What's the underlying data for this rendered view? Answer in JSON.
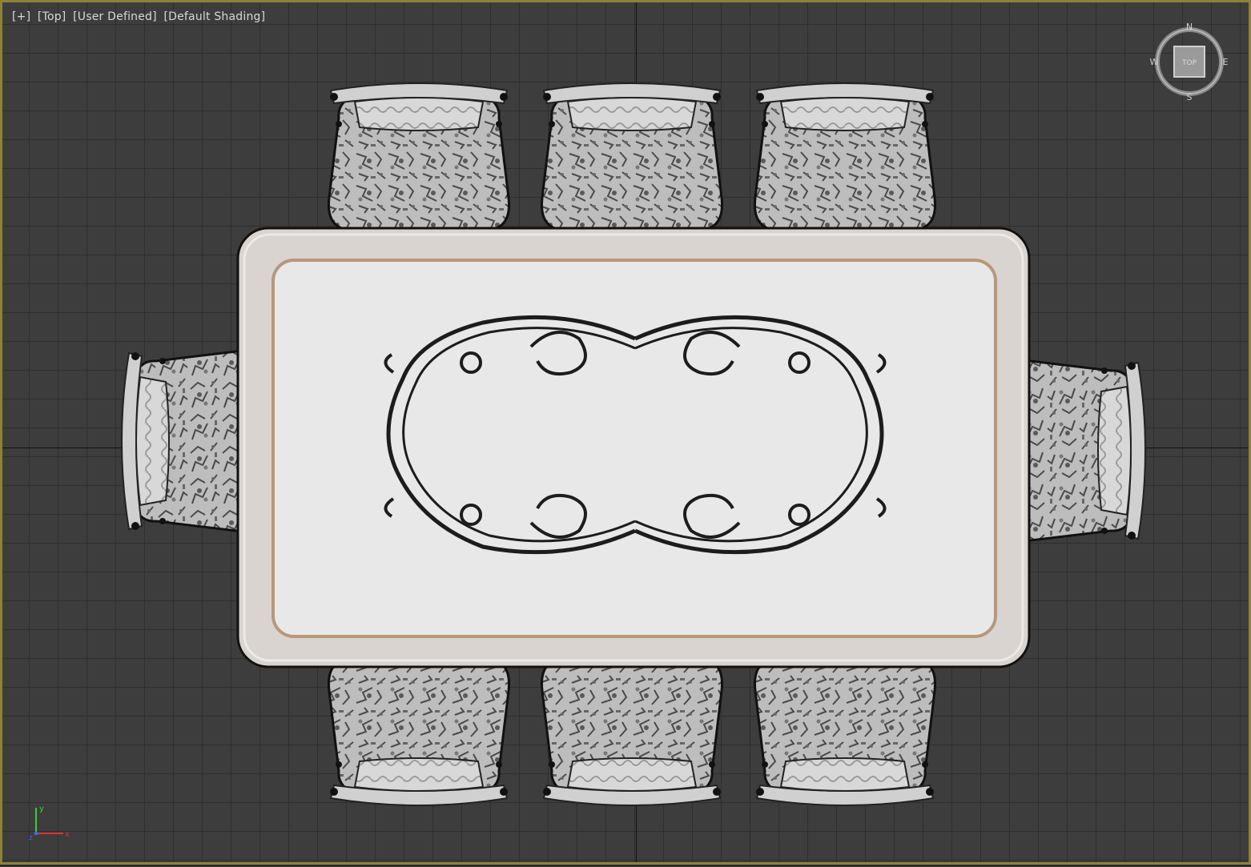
{
  "viewport": {
    "labels": [
      "[+]",
      "[Top]",
      "[User Defined]",
      "[Default Shading]"
    ]
  },
  "viewcube": {
    "face_label": "TOP",
    "compass": {
      "north": "N",
      "south": "S",
      "east": "E",
      "west": "W"
    }
  },
  "axis_tripod": {
    "x": "x",
    "y": "y",
    "z": "z"
  },
  "colors": {
    "grid_background": "#3d3d3d",
    "grid_line": "#2f2f2f",
    "viewport_border": "#8c8238",
    "table_frame": "#d9d4d0",
    "table_inlay_border": "#b8977a",
    "table_top": "#e8e8e8"
  }
}
